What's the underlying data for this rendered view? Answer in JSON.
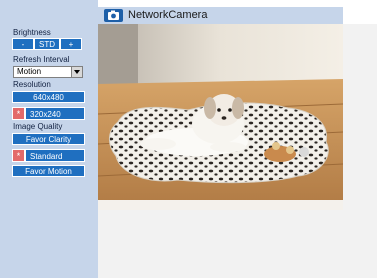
{
  "header": {
    "title": "NetworkCamera",
    "icon": "camera-icon"
  },
  "brightness": {
    "label": "Brightness",
    "minus": "-",
    "std": "STD",
    "plus": "+"
  },
  "refresh": {
    "label": "Refresh Interval",
    "value": "Motion"
  },
  "resolution": {
    "label": "Resolution",
    "options": [
      {
        "label": "640x480",
        "selected": false
      },
      {
        "label": "320x240",
        "selected": true
      }
    ]
  },
  "quality": {
    "label": "Image Quality",
    "options": [
      {
        "label": "Favor Clarity",
        "selected": false
      },
      {
        "label": "Standard",
        "selected": true
      },
      {
        "label": "Favor Motion",
        "selected": false
      }
    ]
  },
  "selected_marker": "*",
  "colors": {
    "accent": "#1f6fc0",
    "selected": "#e36a6a",
    "sidebar": "#c6d5ea"
  }
}
